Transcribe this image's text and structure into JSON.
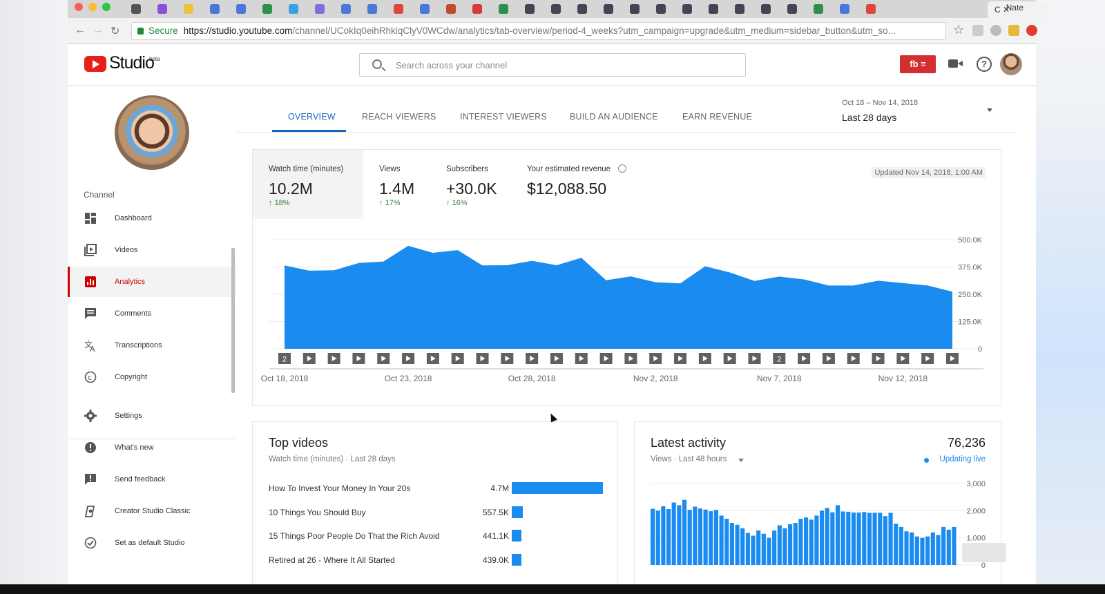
{
  "browser": {
    "active_tab_title": "C",
    "profile_name": "Nate",
    "secure_label": "Secure",
    "url_domain": "https://studio.youtube.com",
    "url_path": "/channel/UCokIq0eihRhkiqClyV0WCdw/analytics/tab-overview/period-4_weeks?utm_campaign=upgrade&utm_medium=sidebar_button&utm_so..."
  },
  "header": {
    "brand": "Studio",
    "beta": "beta",
    "search_placeholder": "Search across your channel",
    "badge_label": "fb ≡"
  },
  "sidebar": {
    "section_label": "Channel",
    "items": [
      {
        "label": "Dashboard",
        "icon": "dashboard-icon",
        "active": false
      },
      {
        "label": "Videos",
        "icon": "videos-icon",
        "active": false
      },
      {
        "label": "Analytics",
        "icon": "analytics-icon",
        "active": true
      },
      {
        "label": "Comments",
        "icon": "comments-icon",
        "active": false
      },
      {
        "label": "Transcriptions",
        "icon": "translate-icon",
        "active": false
      },
      {
        "label": "Copyright",
        "icon": "copyright-icon",
        "active": false
      },
      {
        "label": "Settings",
        "icon": "gear-icon",
        "active": false
      },
      {
        "label": "What's new",
        "icon": "whats-new-icon",
        "active": false
      },
      {
        "label": "Send feedback",
        "icon": "feedback-icon",
        "active": false
      },
      {
        "label": "Creator Studio Classic",
        "icon": "classic-studio-icon",
        "active": false
      },
      {
        "label": "Set as default Studio",
        "icon": "check-circle-icon",
        "active": false
      }
    ]
  },
  "tabs": [
    {
      "label": "OVERVIEW",
      "active": true
    },
    {
      "label": "REACH VIEWERS",
      "active": false
    },
    {
      "label": "INTEREST VIEWERS",
      "active": false
    },
    {
      "label": "BUILD AN AUDIENCE",
      "active": false
    },
    {
      "label": "EARN REVENUE",
      "active": false
    }
  ],
  "date_picker": {
    "range": "Oct 18 – Nov 14, 2018",
    "label": "Last 28 days"
  },
  "metrics": {
    "watch_time": {
      "label": "Watch time (minutes)",
      "value": "10.2M",
      "delta": "18%"
    },
    "views": {
      "label": "Views",
      "value": "1.4M",
      "delta": "17%"
    },
    "subscribers": {
      "label": "Subscribers",
      "value": "+30.0K",
      "delta": "16%"
    },
    "revenue": {
      "label": "Your estimated revenue",
      "value": "$12,088.50"
    },
    "updated": "Updated Nov 14, 2018, 1:00 AM"
  },
  "chart_data": [
    {
      "type": "area",
      "x_labels": [
        "Oct 18, 2018",
        "Oct 23, 2018",
        "Oct 28, 2018",
        "Nov 2, 2018",
        "Nov 7, 2018",
        "Nov 12, 2018"
      ],
      "values": [
        382000,
        358000,
        360000,
        393000,
        400000,
        472000,
        440000,
        452000,
        382000,
        383000,
        403000,
        383000,
        417000,
        314000,
        332000,
        305000,
        300000,
        378000,
        350000,
        311000,
        331000,
        318000,
        290000,
        290000,
        312000,
        301000,
        290000,
        262000
      ],
      "yticks": [
        "0",
        "125.0K",
        "250.0K",
        "375.0K",
        "500.0K"
      ],
      "ylim": [
        0,
        500000
      ],
      "color": "#1a8cf0",
      "markers": [
        "2",
        "",
        "",
        "",
        "",
        "",
        "",
        "",
        "",
        "",
        "",
        "",
        "",
        "",
        "",
        "",
        "",
        "",
        "",
        "",
        "2",
        "",
        "",
        "",
        "",
        "",
        "",
        ""
      ]
    },
    {
      "type": "bar",
      "values": [
        2070,
        2000,
        2160,
        2060,
        2300,
        2200,
        2400,
        2030,
        2150,
        2080,
        2040,
        1980,
        2030,
        1820,
        1700,
        1550,
        1480,
        1350,
        1180,
        1080,
        1270,
        1150,
        1000,
        1270,
        1460,
        1350,
        1500,
        1550,
        1700,
        1750,
        1670,
        1820,
        2000,
        2100,
        1940,
        2200,
        1970,
        1960,
        1930,
        1930,
        1950,
        1920,
        1920,
        1920,
        1800,
        1920,
        1520,
        1400,
        1240,
        1200,
        1050,
        1000,
        1050,
        1200,
        1100,
        1400,
        1300,
        1400
      ],
      "yticks": [
        "0",
        "1,000",
        "2,000",
        "3,000"
      ],
      "ylim": [
        0,
        3000
      ],
      "color": "#1a8cf0"
    }
  ],
  "top_videos": {
    "title": "Top videos",
    "subtitle": "Watch time (minutes) · Last 28 days",
    "rows": [
      {
        "title": "How To Invest Your Money In Your 20s",
        "value_label": "4.7M",
        "value": 4700000
      },
      {
        "title": "10 Things You Should Buy",
        "value_label": "557.5K",
        "value": 557500
      },
      {
        "title": "15 Things Poor People Do That the Rich Avoid",
        "value_label": "441.1K",
        "value": 441100
      },
      {
        "title": "Retired at 26 - Where It All Started",
        "value_label": "439.0K",
        "value": 439000
      }
    ]
  },
  "latest_activity": {
    "title": "Latest activity",
    "subtitle": "Views · Last 48 hours",
    "count": "76,236",
    "live_label": "Updating live"
  }
}
